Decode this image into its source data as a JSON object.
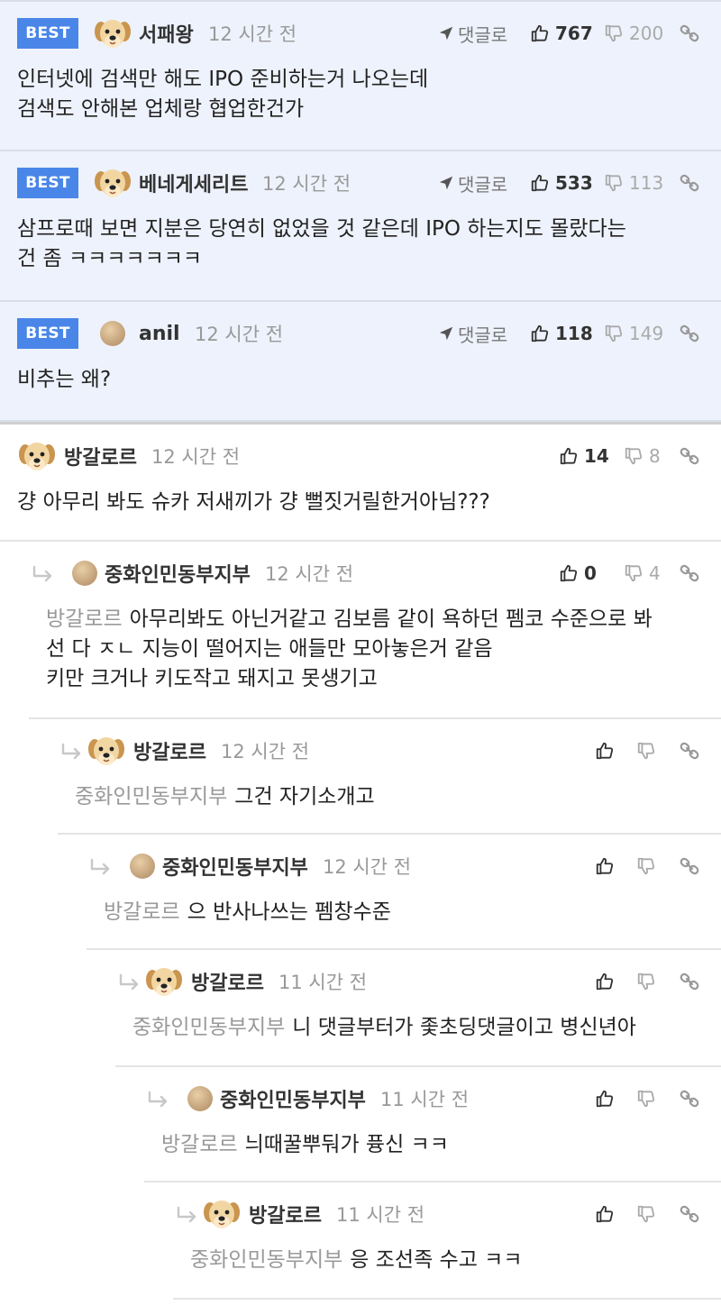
{
  "best_comments": [
    {
      "badge": "BEST",
      "author": "서패왕",
      "time": "12 시간 전",
      "reply_label": "댓글로",
      "likes": "767",
      "dislikes": "200",
      "text": "인터넷에 검색만 해도 IPO 준비하는거 나오는데\n검색도 안해본 업체랑 협업한건가",
      "avatar": "dog-avatar"
    },
    {
      "badge": "BEST",
      "author": "베네게세리트",
      "time": "12 시간 전",
      "reply_label": "댓글로",
      "likes": "533",
      "dislikes": "113",
      "text": "삼프로때 보면 지분은 당연히 없었을 것 같은데 IPO 하는지도 몰랐다는\n건 좀 ㅋㅋㅋㅋㅋㅋㅋ",
      "avatar": "dog-avatar"
    },
    {
      "badge": "BEST",
      "author": "anil",
      "time": "12 시간 전",
      "reply_label": "댓글로",
      "likes": "118",
      "dislikes": "149",
      "text": "비추는 왜?",
      "avatar": "ball-avatar"
    }
  ],
  "comments": [
    {
      "depth": 0,
      "author": "방갈로르",
      "time": "12 시간 전",
      "likes": "14",
      "dislikes": "8",
      "mention": "",
      "text": "걍 아무리 봐도 슈카 저새끼가 걍 뻘짓거릴한거아님???",
      "avatar": "dog-avatar"
    },
    {
      "depth": 1,
      "author": "중화인민동부지부",
      "time": "12 시간 전",
      "likes": "0",
      "dislikes": "4",
      "mention": "방갈로르",
      "text": "아무리봐도 아닌거같고 김보름 같이 욕하던 펨코 수준으로 봐\n선 다 ㅈㄴ 지능이 떨어지는 애들만 모아놓은거 같음\n키만 크거나 키도작고 돼지고 못생기고",
      "avatar": "ball-avatar"
    },
    {
      "depth": 2,
      "author": "방갈로르",
      "time": "12 시간 전",
      "likes": "",
      "dislikes": "",
      "mention": "중화인민동부지부",
      "text": "그건 자기소개고",
      "avatar": "dog-avatar"
    },
    {
      "depth": 3,
      "author": "중화인민동부지부",
      "time": "12 시간 전",
      "likes": "",
      "dislikes": "",
      "mention": "방갈로르",
      "text": "으 반사나쓰는 펨창수준",
      "avatar": "ball-avatar"
    },
    {
      "depth": 4,
      "author": "방갈로르",
      "time": "11 시간 전",
      "likes": "",
      "dislikes": "",
      "mention": "중화인민동부지부",
      "text": "니 댓글부터가 좇초딩댓글이고 병신년아",
      "avatar": "dog-avatar"
    },
    {
      "depth": 5,
      "author": "중화인민동부지부",
      "time": "11 시간 전",
      "likes": "",
      "dislikes": "",
      "mention": "방갈로르",
      "text": "늬때꿀뿌둬가 퓽신 ㅋㅋ",
      "avatar": "ball-avatar"
    },
    {
      "depth": 6,
      "author": "방갈로르",
      "time": "11 시간 전",
      "likes": "",
      "dislikes": "",
      "mention": "중화인민동부지부",
      "text": "응 조선족 수고 ㅋㅋ",
      "avatar": "dog-avatar"
    }
  ],
  "colors": {
    "best_bg": "#eef2fc",
    "badge": "#4a86e8",
    "muted": "#999999"
  }
}
